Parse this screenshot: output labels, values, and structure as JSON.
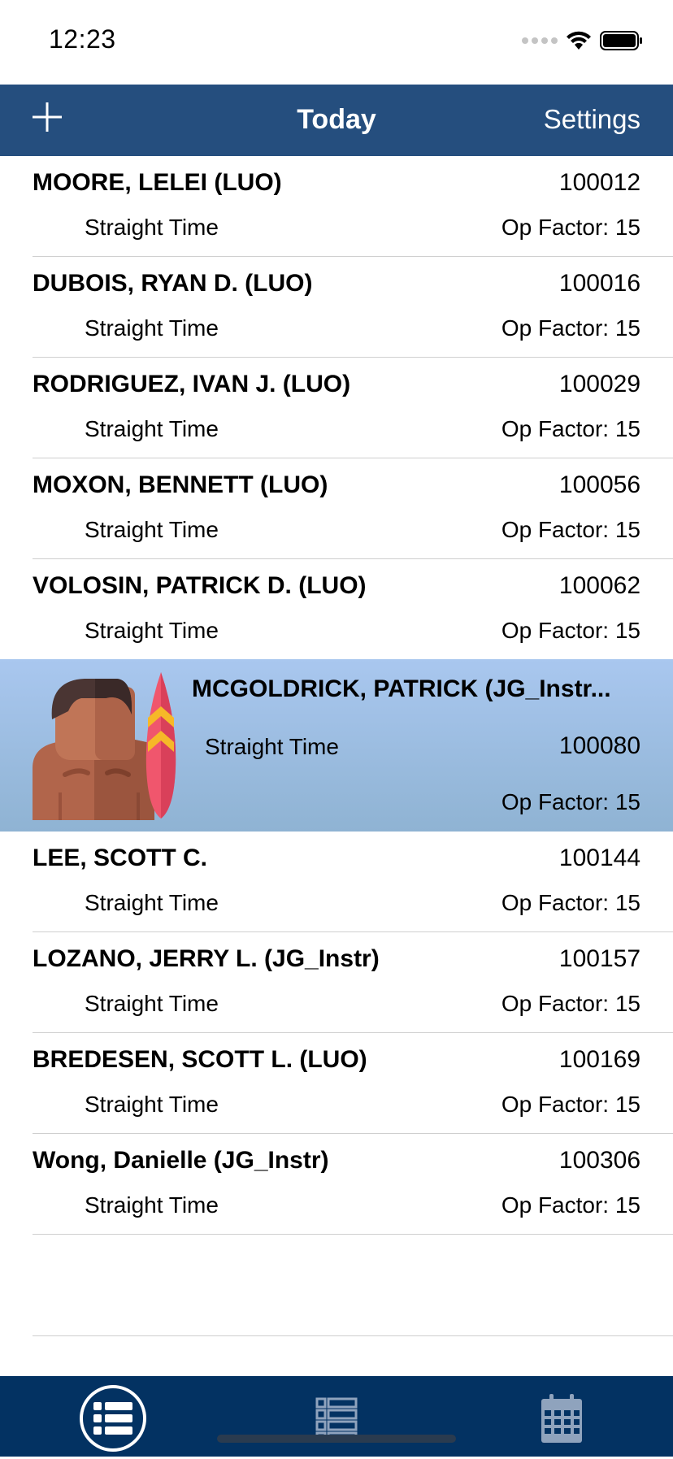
{
  "status_bar": {
    "time": "12:23"
  },
  "nav": {
    "title": "Today",
    "settings_label": "Settings",
    "add_icon": "plus-icon"
  },
  "rows": [
    {
      "name": "MOORE, LELEI (LUO)",
      "number": "100012",
      "type": "Straight Time",
      "factor": "Op Factor: 15"
    },
    {
      "name": "DUBOIS, RYAN D. (LUO)",
      "number": "100016",
      "type": "Straight Time",
      "factor": "Op Factor: 15"
    },
    {
      "name": "RODRIGUEZ, IVAN J. (LUO)",
      "number": "100029",
      "type": "Straight Time",
      "factor": "Op Factor: 15"
    },
    {
      "name": "MOXON, BENNETT (LUO)",
      "number": "100056",
      "type": "Straight Time",
      "factor": "Op Factor: 15"
    },
    {
      "name": "VOLOSIN, PATRICK D. (LUO)",
      "number": "100062",
      "type": "Straight Time",
      "factor": "Op Factor: 15"
    }
  ],
  "selected": {
    "name": "MCGOLDRICK, PATRICK (JG_Instr...",
    "number": "100080",
    "type": "Straight Time",
    "factor": "Op Factor: 15",
    "avatar_icon": "surfer-avatar-icon"
  },
  "rows_after": [
    {
      "name": "LEE, SCOTT C.",
      "number": "100144",
      "type": "Straight Time",
      "factor": "Op Factor: 15"
    },
    {
      "name": "LOZANO, JERRY L. (JG_Instr)",
      "number": "100157",
      "type": "Straight Time",
      "factor": "Op Factor: 15"
    },
    {
      "name": "BREDESEN, SCOTT L. (LUO)",
      "number": "100169",
      "type": "Straight Time",
      "factor": "Op Factor: 15"
    },
    {
      "name": "Wong, Danielle (JG_Instr)",
      "number": "100306",
      "type": "Straight Time",
      "factor": "Op Factor: 15"
    }
  ],
  "tabs": [
    {
      "icon": "list-icon",
      "active": true
    },
    {
      "icon": "grid-list-icon",
      "active": false
    },
    {
      "icon": "calendar-icon",
      "active": false
    }
  ],
  "colors": {
    "nav_background": "#254e7e",
    "tab_background": "#033262",
    "selected_row": "#a9c7ef"
  }
}
